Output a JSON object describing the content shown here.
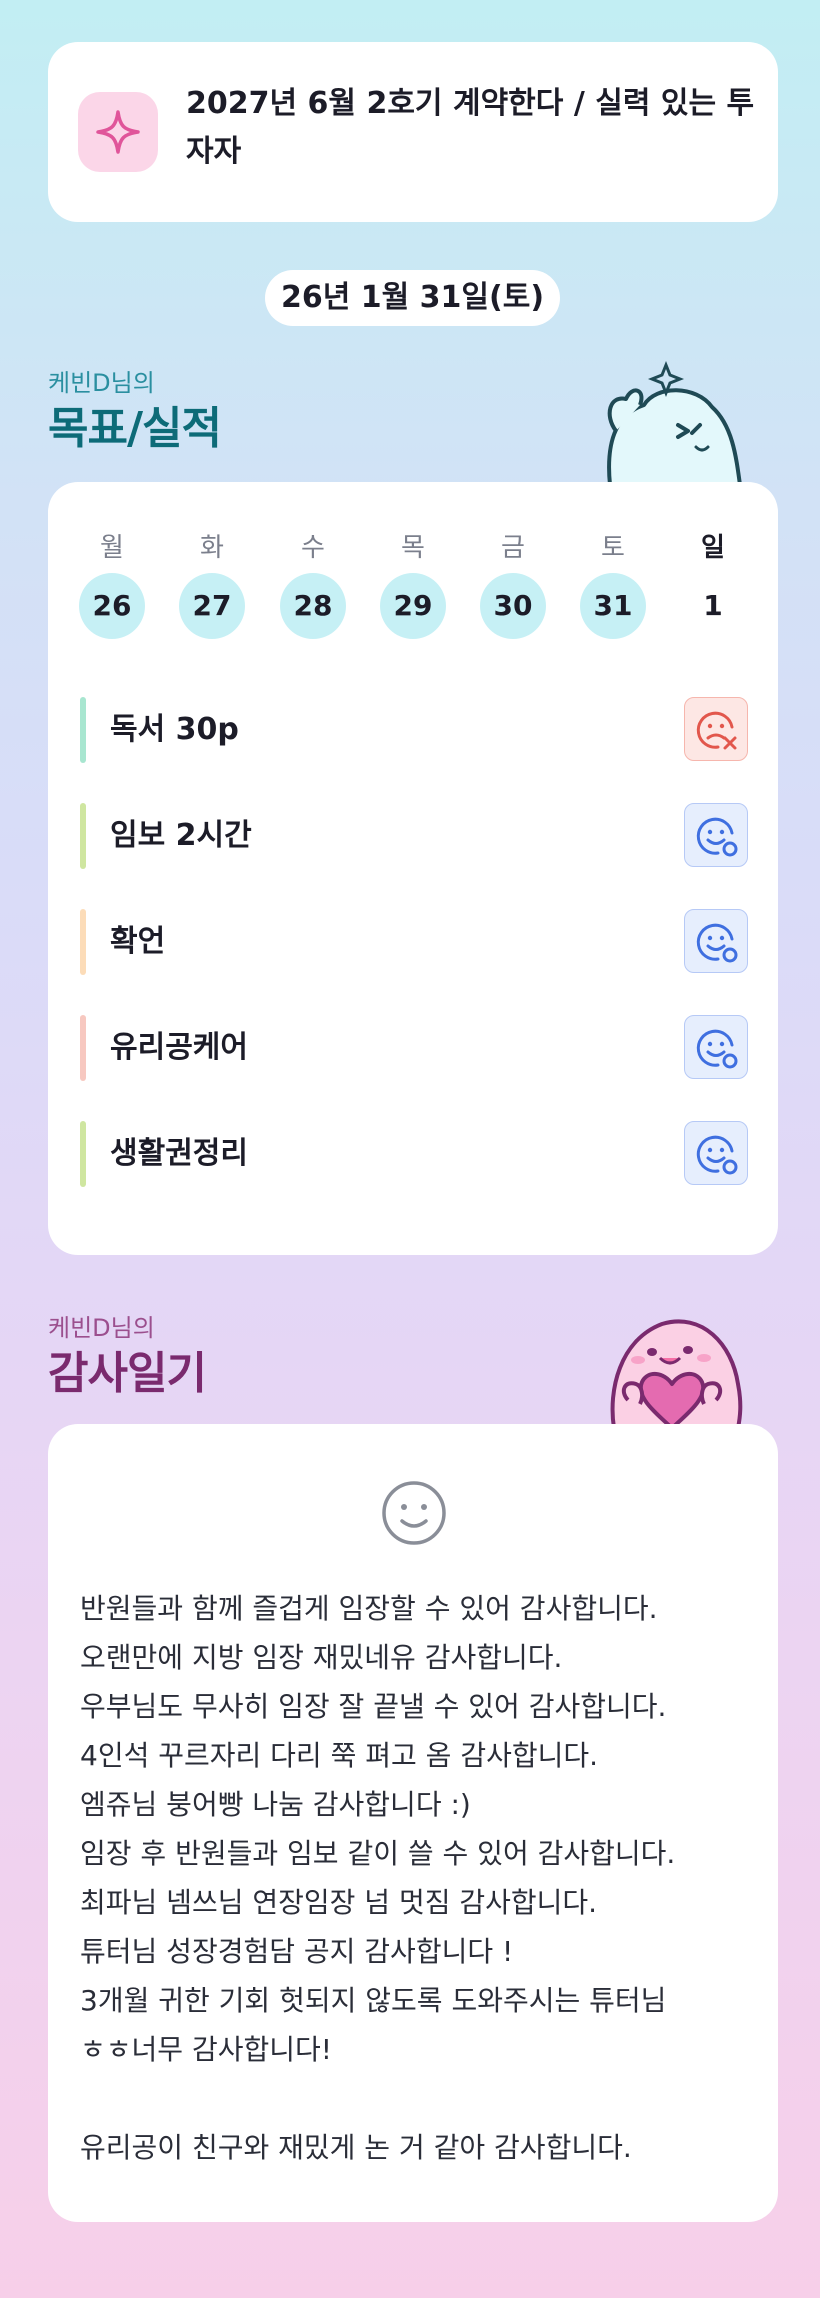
{
  "goal": {
    "icon": "sparkle-icon",
    "line1": "2027년 6월 2호기 계약한다 / 실력 있는 투",
    "line2": "자자"
  },
  "date_label": "26년 1월 31일(토)",
  "goals_section": {
    "subtitle": "케빈D님의",
    "title": "목표/실적",
    "days": [
      {
        "name": "월",
        "num": "26"
      },
      {
        "name": "화",
        "num": "27"
      },
      {
        "name": "수",
        "num": "28"
      },
      {
        "name": "목",
        "num": "29"
      },
      {
        "name": "금",
        "num": "30"
      },
      {
        "name": "토",
        "num": "31"
      },
      {
        "name": "일",
        "num": "1"
      }
    ],
    "tasks": [
      {
        "label": "독서 30p",
        "status": "fail",
        "bar_color": "#a8e6d0"
      },
      {
        "label": "임보 2시간",
        "status": "done",
        "bar_color": "#cfe6a0"
      },
      {
        "label": "확언",
        "status": "done",
        "bar_color": "#fcdcb8"
      },
      {
        "label": "유리공케어",
        "status": "done",
        "bar_color": "#f7c8c0"
      },
      {
        "label": "생활권정리",
        "status": "done",
        "bar_color": "#cfe6a0"
      }
    ]
  },
  "gratitude_section": {
    "subtitle": "케빈D님의",
    "title": "감사일기",
    "lines": [
      "반원들과 함께 즐겁게 임장할 수 있어 감사합니다.",
      "오랜만에 지방 임장 재밌네유 감사합니다.",
      "우부님도 무사히 임장 잘 끝낼 수 있어 감사합니다.",
      "4인석 꾸르자리 다리 쭉 펴고 옴 감사합니다.",
      "엠쥬님 붕어빵 나눔 감사합니다 :)",
      "임장 후 반원들과 임보 같이 쓸 수 있어 감사합니다.",
      "최파님 넴쓰님 연장임장 넘 멋짐 감사합니다.",
      "튜터님 성장경험담 공지 감사합니다 !",
      "3개월 귀한 기회 헛되지 않도록 도와주시는 튜터님",
      "ㅎㅎ너무 감사합니다!",
      "",
      "유리공이 친구와 재밌게 논 거 같아 감사합니다."
    ]
  },
  "colors": {
    "goals_subtitle": "#2a8fa0",
    "goals_title": "#0d6b78",
    "gratitude_subtitle": "#9b4f8e",
    "gratitude_title": "#7a2a6e",
    "pink_icon": "#e0559a",
    "fail_icon": "#e2574c",
    "done_icon": "#3f6fe0"
  }
}
